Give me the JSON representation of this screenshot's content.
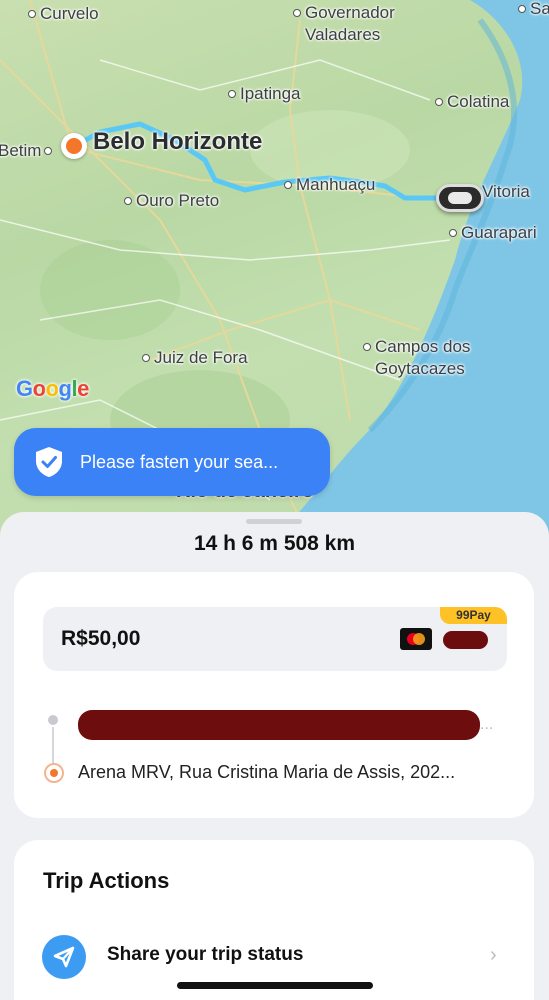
{
  "map": {
    "cities": {
      "curvelo": "Curvelo",
      "governador": "Governador\nValadares",
      "sa": "Sa",
      "ipatinga": "Ipatinga",
      "colatina": "Colatina",
      "betim": "Betim",
      "belo_horizonte": "Belo Horizonte",
      "manhuacu": "Manhuaçu",
      "vitoria": "Vitoria",
      "ouro_preto": "Ouro Preto",
      "guarapari": "Guarapari",
      "campos": "Campos dos\nGoytacazes",
      "juiz_de_fora": "Juiz de Fora",
      "rio": "Rio de Janeiro"
    },
    "logo": "Google",
    "route_color": "#5ac8f5"
  },
  "toast": {
    "message": "Please fasten your sea..."
  },
  "trip": {
    "summary": "14 h 6 m  508 km"
  },
  "payment": {
    "price": "R$50,00",
    "badge": "99Pay"
  },
  "route": {
    "destination": "Arena MRV, Rua Cristina Maria de Assis, 202...",
    "tail": "..."
  },
  "actions": {
    "title": "Trip Actions",
    "share_label": "Share your trip status"
  },
  "colors": {
    "accent": "#3b82f6",
    "origin": "#f4762b",
    "badge": "#ffc226"
  }
}
